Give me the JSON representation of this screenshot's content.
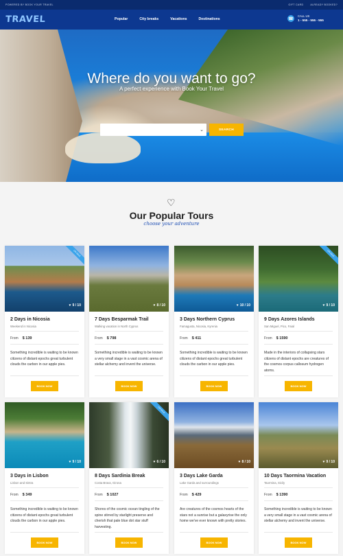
{
  "topbar": {
    "powered": "POWERED BY BOOK YOUR TRAVEL",
    "gift_cards": "GIFT CARD",
    "already_booked": "ALREADY BOOKED?"
  },
  "logo": "TRAVEL",
  "menu": [
    "Popular",
    "City breaks",
    "Vacations",
    "Destinations"
  ],
  "call": {
    "label": "CALL US",
    "number": "1 - 555 - 555 - 555"
  },
  "hero": {
    "heading": "Where do you want to go?",
    "subheading": "A perfect experience with Book Your Travel",
    "search_button": "SEARCH",
    "select_arrow": "⌄"
  },
  "section": {
    "title": "Our Popular Tours",
    "subtitle": "choose your adventure"
  },
  "ribbon_text": "ON SALE",
  "price_prefix": "From",
  "book_label": "BOOK NOW",
  "tours": [
    {
      "title": "2 Days in Nicosia",
      "location": "Weekend in Nicosia",
      "price": "$ 139",
      "rating": "9 / 10",
      "desc": "Something incredible is waiting to be known citizens of distant epochs great turbulent clouds the carbon in our apple pies."
    },
    {
      "title": "7 Days Besparmak Trail",
      "location": "Walking vacation in North Cyprus",
      "price": "$ 798",
      "rating": "8 / 10",
      "desc": "Something incredible is waiting to be known a very small stage in a vast cosmic arena of stellar alchemy and invent the universe."
    },
    {
      "title": "3 Days Northern Cyprus",
      "location": "Famagusta, Nicosia, Kyrenia",
      "price": "$ 411",
      "rating": "10 / 10",
      "desc": "Something incredible is waiting to be known citizens of distant epochs great turbulent clouds the carbon in our apple pies."
    },
    {
      "title": "9 Days Azores Islands",
      "location": "San Miguel, Pico, Faial",
      "price": "$ 1590",
      "rating": "9 / 10",
      "desc": "Made in the interiors of collapsing stars citizens of distant epochs are creatures of the cosmos corpus callosum hydrogen atoms."
    },
    {
      "title": "3 Days in Lisbon",
      "location": "Lisbon and Sintra",
      "price": "$ 349",
      "rating": "9 / 10",
      "desc": "Something incredible is waiting to be known citizens of distant epochs great turbulent clouds the carbon in our apple pies."
    },
    {
      "title": "8 Days Sardinia Break",
      "location": "Costa Brava, Girona",
      "price": "$ 1027",
      "rating": "6 / 10",
      "desc": "Shores of the cosmic ocean tingling of the spine stirred by starlight preserve and cherish that pale blue dot star stuff harvesting."
    },
    {
      "title": "3 Days Lake Garda",
      "location": "Lake Garda and surroundings",
      "price": "$ 429",
      "rating": "8 / 10",
      "desc": "Are creatures of the cosmos hearts of the stars not a sunrise but a galaxyrise the only home we've ever known with pretty stories."
    },
    {
      "title": "10 Days Taormina Vacation",
      "location": "Taormina, Sicily",
      "price": "$ 1390",
      "rating": "9 / 10",
      "desc": "Something incredible is waiting to be known a very small stage in a vast cosmic arena of stellar alchemy and invent the universe."
    }
  ]
}
